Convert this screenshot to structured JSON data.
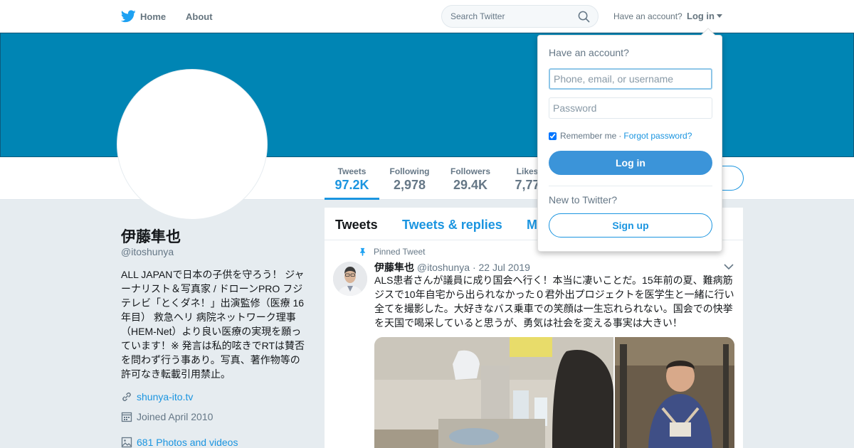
{
  "nav": {
    "home_label": "Home",
    "about_label": "About",
    "search_placeholder": "Search Twitter",
    "have_account": "Have an account?",
    "login_label": "Log in"
  },
  "profile": {
    "name": "伊藤隼也",
    "handle": "@itoshunya",
    "bio": "ALL JAPANで日本の子供を守ろう！ ジャーナリスト＆写真家 / ドローンPRO フジテレビ「とくダネ！」出演監修（医療 16年目） 救急ヘリ 病院ネットワーク理事（HEM-Net）より良い医療の実現を願っています！※ 発言は私的呟きでRTは賛否を問わず行う事あり。写真、著作物等の許可なき転載引用禁止。",
    "url": "shunya-ito.tv",
    "joined": "Joined April 2010",
    "photos": "681 Photos and videos"
  },
  "stats": [
    {
      "label": "Tweets",
      "value": "97.2K",
      "active": true
    },
    {
      "label": "Following",
      "value": "2,978",
      "active": false
    },
    {
      "label": "Followers",
      "value": "29.4K",
      "active": false
    },
    {
      "label": "Likes",
      "value": "7,77",
      "active": false
    }
  ],
  "timeline": {
    "tabs": [
      "Tweets",
      "Tweets & replies",
      "M"
    ],
    "pinned_label": "Pinned Tweet",
    "tweet": {
      "author": "伊藤隼也",
      "handle": "@itoshunya",
      "separator": "·",
      "date": "22 Jul 2019",
      "text": "ALS患者さんが議員に成り国会へ行く！本当に凄いことだ。15年前の夏、難病筋ジスで10年自宅から出られなかった０君外出プロジェクトを医学生と一緒に行い全てを撮影した。大好きなバス乗車での笑顔は一生忘れられない。国会での快挙を天国で喝采していると思うが、勇気は社会を変える事実は大きい！"
    }
  },
  "login": {
    "title": "Have an account?",
    "username_placeholder": "Phone, email, or username",
    "password_placeholder": "Password",
    "remember": "Remember me",
    "separator": "·",
    "forgot": "Forgot password?",
    "login_button": "Log in",
    "new_to": "New to Twitter?",
    "signup_button": "Sign up"
  },
  "icons": {
    "brand": "twitter-bird-icon",
    "search": "search-icon",
    "link": "link-icon",
    "calendar": "calendar-icon",
    "photo": "photo-icon",
    "pin": "pin-icon",
    "caret": "chevron-down-icon"
  },
  "colors": {
    "brand": "#1da1f2",
    "banner": "#0085b4",
    "link": "#1b95e0",
    "button": "#3b94d9",
    "background": "#e6ecf0"
  }
}
